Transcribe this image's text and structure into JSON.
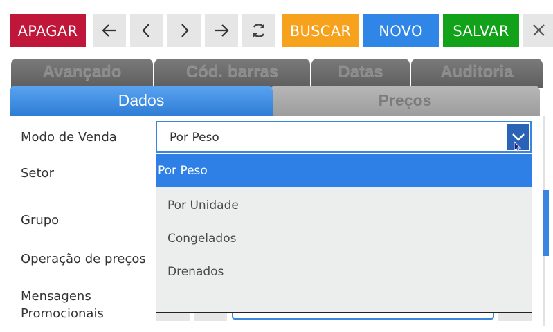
{
  "toolbar": {
    "apagar": "APAGAR",
    "buscar": "BUSCAR",
    "novo": "NOVO",
    "salvar": "SALVAR",
    "icons": [
      "arrow-left-icon",
      "chevron-left-icon",
      "chevron-right-icon",
      "arrow-right-icon",
      "refresh-icon",
      "close-icon"
    ],
    "colors": {
      "apagar": "#c0163a",
      "buscar": "#f7a21c",
      "novo": "#2f86e6",
      "salvar": "#12a21a",
      "icon_bg": "#e6e6e6"
    }
  },
  "tabs": {
    "back_row": [
      "Avançado",
      "Cód. barras",
      "Datas",
      "Auditoria"
    ],
    "front_row": [
      "Dados",
      "Preços"
    ],
    "active": "Dados"
  },
  "form": {
    "labels": {
      "modo_venda": "Modo de Venda",
      "setor": "Setor",
      "grupo": "Grupo",
      "operacao_precos": "Operação de preços",
      "mensagens_line1": "Mensagens",
      "mensagens_line2": "Promocionais"
    },
    "modo_venda": {
      "value": "Por Peso",
      "options": [
        "Por Peso",
        "Por Unidade",
        "Congelados",
        "Drenados"
      ],
      "selected": "Por Peso"
    }
  }
}
